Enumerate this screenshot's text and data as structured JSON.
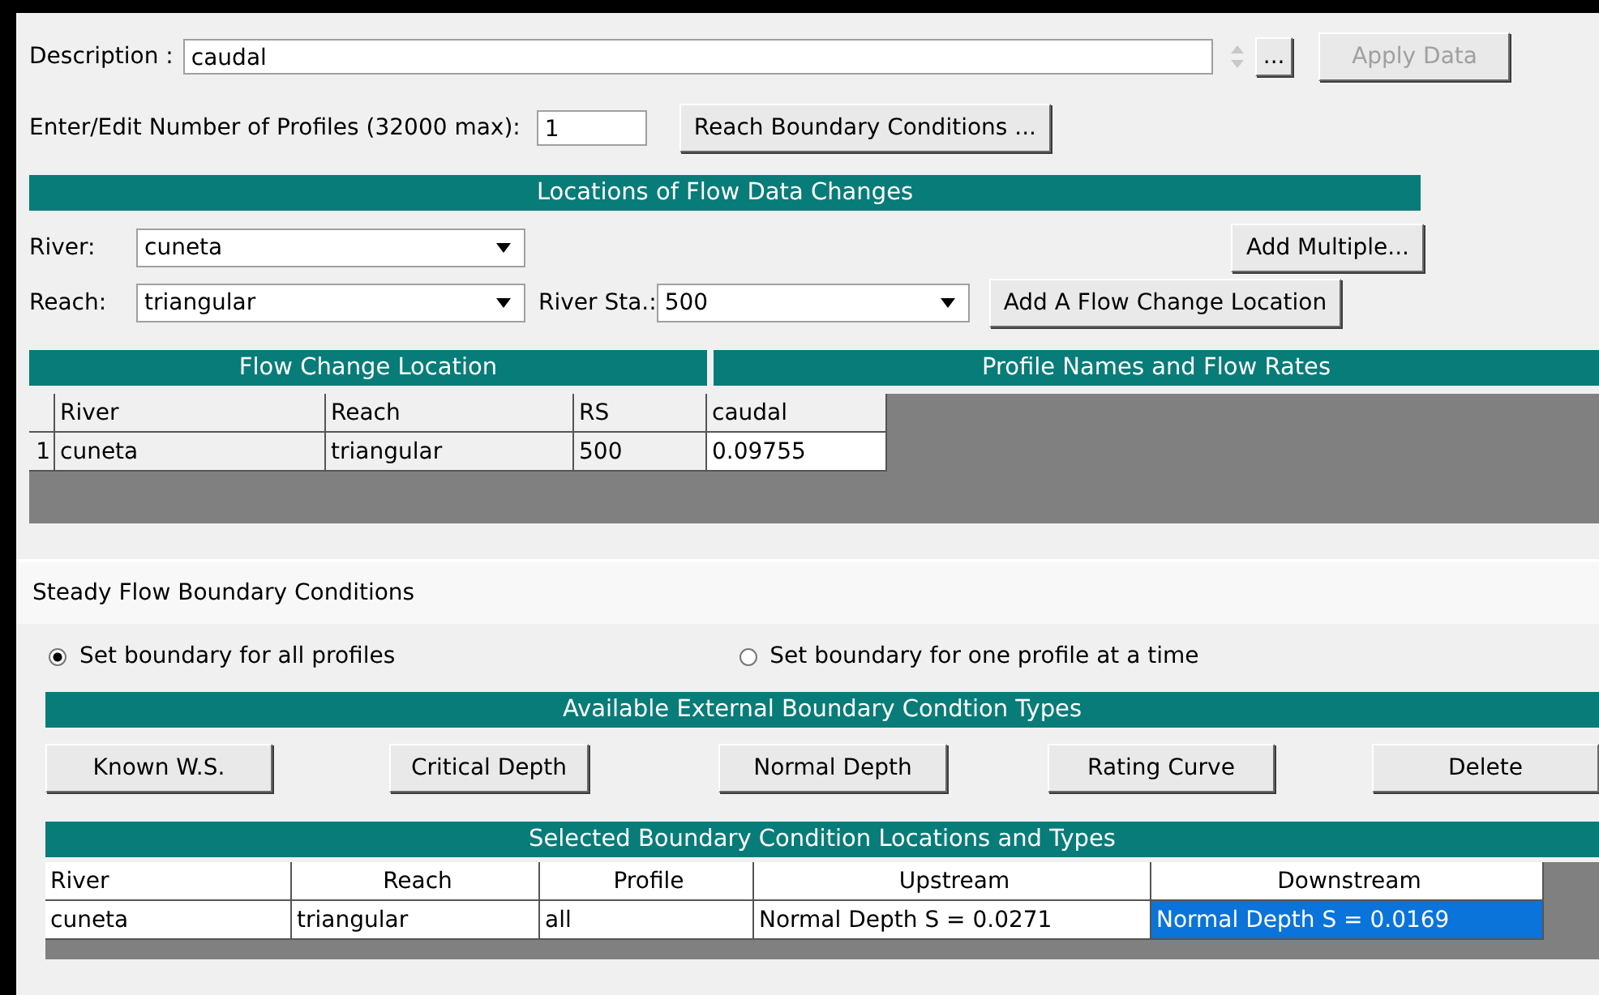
{
  "description": {
    "label": "Description :",
    "value": "caudal",
    "browse": "...",
    "apply": "Apply Data",
    "apply_disabled": true
  },
  "profiles": {
    "label": "Enter/Edit Number of Profiles (32000 max):",
    "value": "1",
    "button": "Reach Boundary Conditions ..."
  },
  "locations": {
    "title": "Locations of Flow Data Changes",
    "river_label": "River:",
    "river": "cuneta",
    "add_multiple": "Add Multiple...",
    "reach_label": "Reach:",
    "reach": "triangular",
    "station_label": "River Sta.:",
    "station": "500",
    "add_location": "Add A Flow Change Location"
  },
  "flow_table": {
    "left_title": "Flow Change Location",
    "right_title": "Profile Names and Flow Rates",
    "columns": [
      "River",
      "Reach",
      "RS",
      "caudal"
    ],
    "rows": [
      {
        "number": "1",
        "cells": [
          "cuneta",
          "triangular",
          "500",
          "0.09755"
        ]
      }
    ]
  },
  "boundary": {
    "title": "Steady Flow Boundary Conditions",
    "radios": [
      {
        "label": "Set boundary for all profiles",
        "selected": true
      },
      {
        "label": "Set boundary for one profile at a time",
        "selected": false
      }
    ],
    "types_title": "Available External Boundary Condtion Types",
    "buttons": [
      "Known W.S.",
      "Critical Depth",
      "Normal Depth",
      "Rating Curve",
      "Delete"
    ],
    "table_title": "Selected Boundary Condition Locations and Types",
    "columns": [
      "River",
      "Reach",
      "Profile",
      "Upstream",
      "Downstream"
    ],
    "rows": [
      {
        "cells": [
          {
            "text": "cuneta",
            "selected": false
          },
          {
            "text": "triangular",
            "selected": false
          },
          {
            "text": "all",
            "selected": false
          },
          {
            "text": "Normal Depth S = 0.0271",
            "selected": false
          },
          {
            "text": "Normal Depth S = 0.0169",
            "selected": true
          }
        ]
      }
    ]
  }
}
